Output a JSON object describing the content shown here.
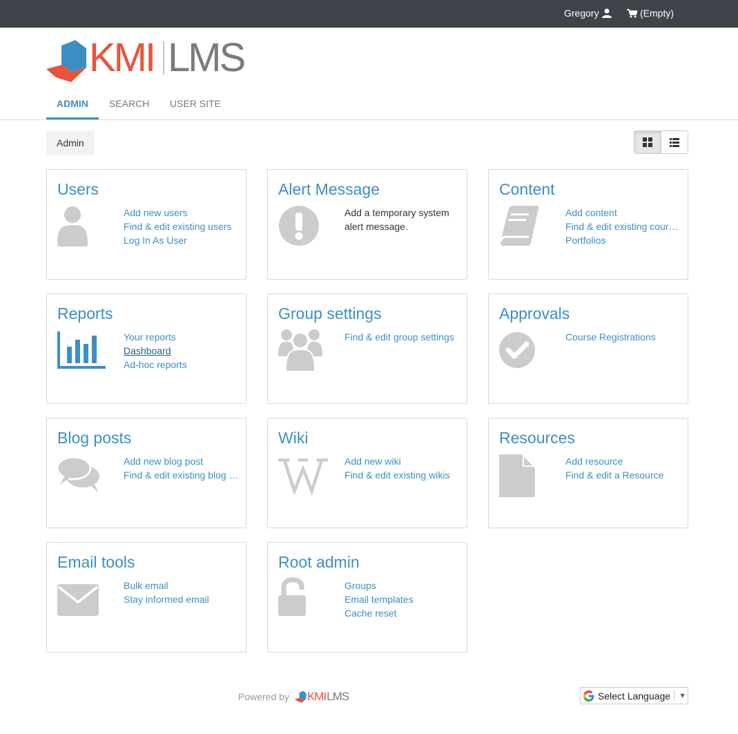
{
  "topbar": {
    "user_name": "Gregory",
    "cart_label": "(Empty)"
  },
  "brand": {
    "logo_kmi": "KMI",
    "logo_lms": "LMS",
    "colors": {
      "accent": "#3c8fc4",
      "brand_orange": "#e8543a",
      "brand_blue": "#3c8fc4",
      "topbar": "#3f444b",
      "icon_gray": "#cccccc"
    }
  },
  "nav": {
    "tabs": [
      {
        "label": "ADMIN",
        "active": true
      },
      {
        "label": "SEARCH",
        "active": false
      },
      {
        "label": "USER SITE",
        "active": false
      }
    ]
  },
  "breadcrumb": {
    "label": "Admin"
  },
  "view_toggle": {
    "selected": "grid"
  },
  "cards": [
    {
      "title": "Users",
      "icon": "user-icon",
      "links": [
        "Add new users",
        "Find & edit existing users",
        "Log In As User"
      ]
    },
    {
      "title": "Alert Message",
      "icon": "exclamation-circle-icon",
      "description": "Add a temporary system alert message."
    },
    {
      "title": "Content",
      "icon": "book-icon",
      "links": [
        "Add content",
        "Find & edit existing courses",
        "Portfolios"
      ]
    },
    {
      "title": "Reports",
      "icon": "bar-chart-icon",
      "links": [
        "Your reports",
        "Dashboard",
        "Ad-hoc reports"
      ]
    },
    {
      "title": "Group settings",
      "icon": "users-group-icon",
      "links": [
        "Find & edit group settings"
      ]
    },
    {
      "title": "Approvals",
      "icon": "check-circle-icon",
      "links": [
        "Course Registrations"
      ]
    },
    {
      "title": "Blog posts",
      "icon": "comments-icon",
      "links": [
        "Add new blog post",
        "Find & edit existing blog posts"
      ]
    },
    {
      "title": "Wiki",
      "icon": "wikipedia-icon",
      "links": [
        "Add new wiki",
        "Find & edit existing wikis"
      ]
    },
    {
      "title": "Resources",
      "icon": "file-icon",
      "links": [
        "Add resource",
        "Find & edit a Resource"
      ]
    },
    {
      "title": "Email tools",
      "icon": "envelope-icon",
      "links": [
        "Bulk email",
        "Stay informed email"
      ]
    },
    {
      "title": "Root admin",
      "icon": "unlock-icon",
      "links": [
        "Groups",
        "Email templates",
        "Cache reset"
      ]
    }
  ],
  "footer": {
    "powered_by": "Powered by",
    "logo_kmi": "KMI",
    "logo_lms": "LMS",
    "language_label": "Select Language"
  }
}
